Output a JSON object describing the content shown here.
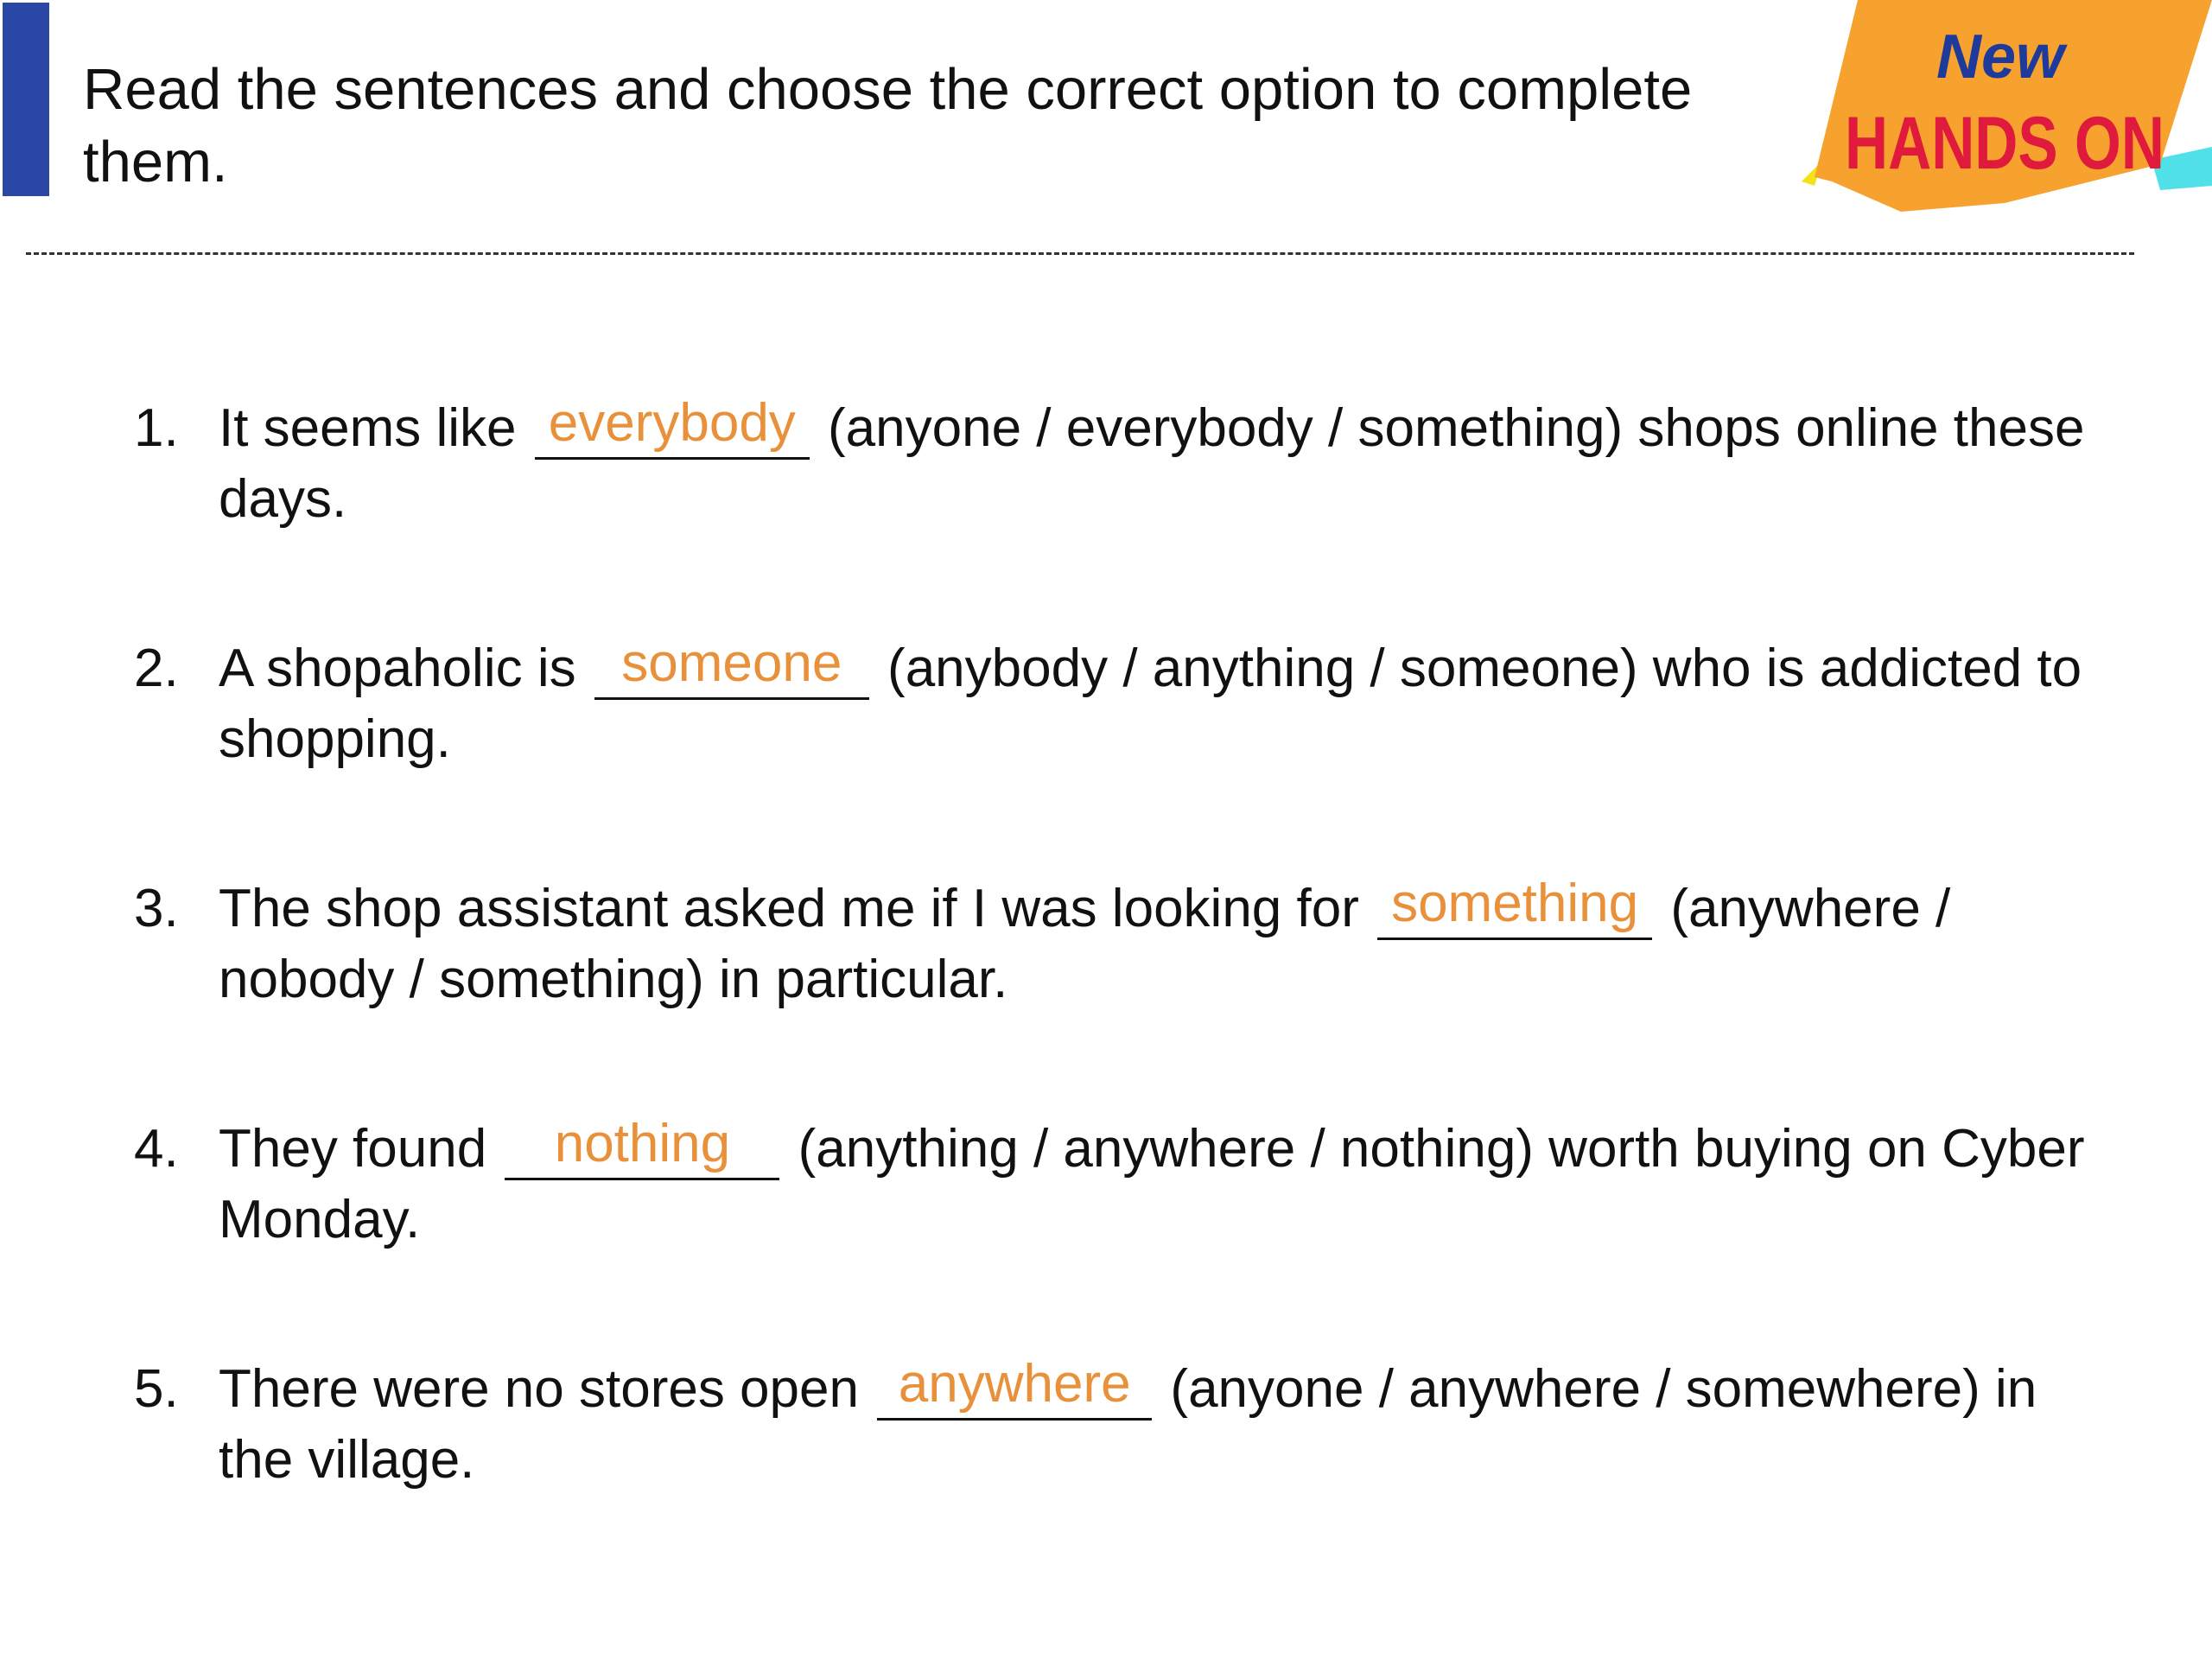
{
  "header": {
    "instruction": "Read the sentences and choose the correct option to complete them.",
    "logo": {
      "line1": "New",
      "line2": "HANDS ON"
    }
  },
  "colors": {
    "accent_bar": "#2a47a6",
    "answer_text": "#e8913a",
    "logo_background": "#f7a22e",
    "logo_new": "#1e3a9a",
    "logo_hands_on": "#e01a3c"
  },
  "exercises": [
    {
      "number": "1.",
      "before": "It seems like ",
      "answer": "everybody",
      "after": " (anyone / everybody / something) shops online these days."
    },
    {
      "number": "2.",
      "before": "A shopaholic is ",
      "answer": "someone",
      "after": " (anybody / anything / someone) who is addicted to shopping."
    },
    {
      "number": "3.",
      "before": "The shop assistant asked me if I was looking for ",
      "answer": "something",
      "after": " (anywhere / nobody / something) in particular."
    },
    {
      "number": "4.",
      "before": "They found ",
      "answer": "nothing",
      "after": " (anything / anywhere / nothing) worth buying on Cyber Monday."
    },
    {
      "number": "5.",
      "before": "There were no stores open ",
      "answer": "anywhere",
      "after": " (anyone / anywhere / somewhere) in the village."
    }
  ]
}
